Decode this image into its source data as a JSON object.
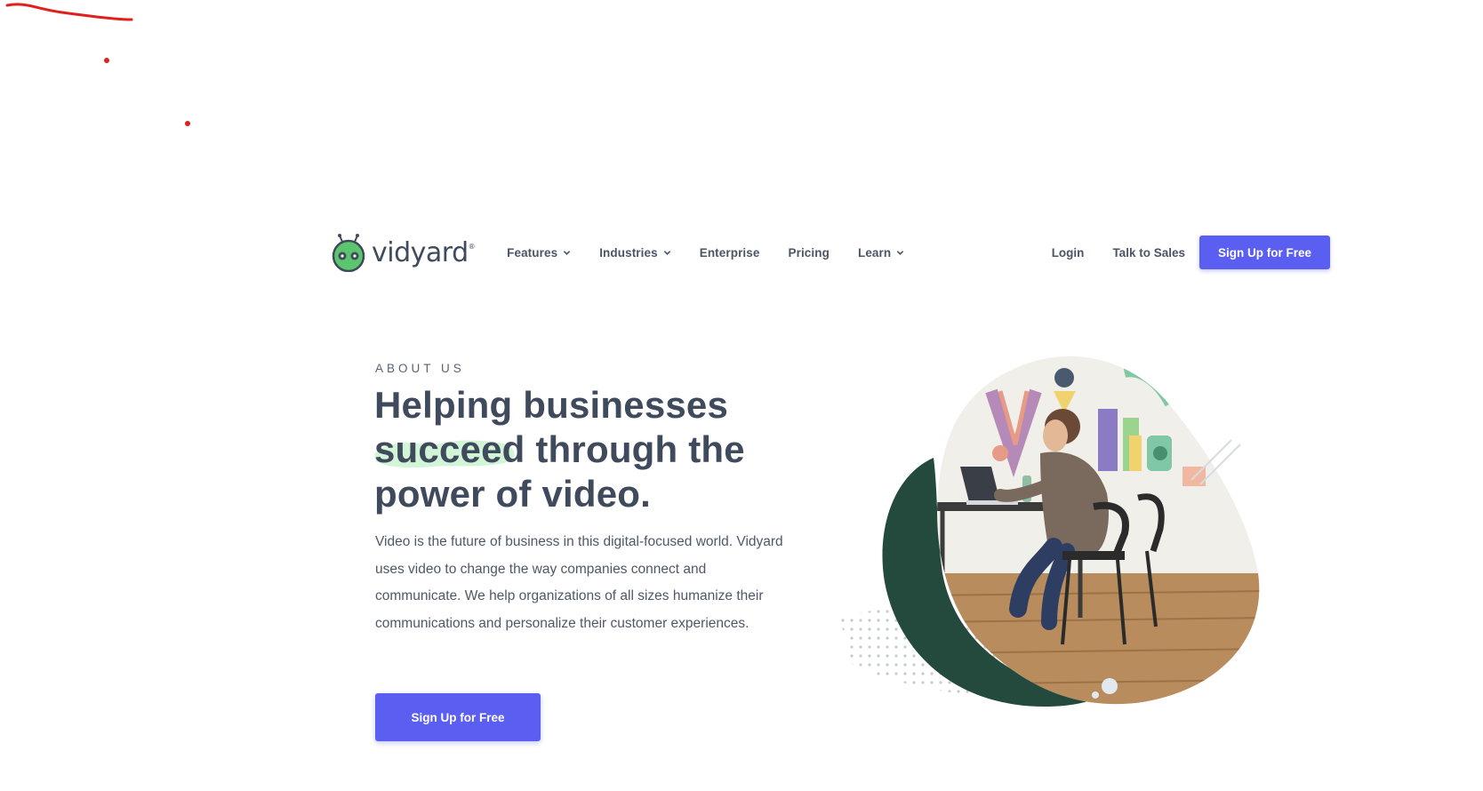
{
  "nav": {
    "logo_text": "vidyard",
    "logo_mark": "®",
    "menu": [
      {
        "label": "Features",
        "has_dropdown": true
      },
      {
        "label": "Industries",
        "has_dropdown": true
      },
      {
        "label": "Enterprise",
        "has_dropdown": false
      },
      {
        "label": "Pricing",
        "has_dropdown": false
      },
      {
        "label": "Learn",
        "has_dropdown": true
      }
    ],
    "login": "Login",
    "talk_to_sales": "Talk to Sales",
    "signup": "Sign Up for Free"
  },
  "hero": {
    "eyebrow": "ABOUT US",
    "headline_line1": "Helping businesses",
    "headline_line2": "succeed through the",
    "headline_line3": "power of video.",
    "highlight_word": "succeed",
    "description": "Video is the future of business in this digital-focused world. Vidyard uses video to change the way companies connect and communicate. We help organizations of all sizes humanize their communications and personalize their customer experiences.",
    "cta": "Sign Up for Free"
  },
  "colors": {
    "accent": "#5a5ff2",
    "text": "#3f4a5c",
    "dark_green": "#234a3c",
    "logo_green": "#5cc56e",
    "highlight_green": "#c9f3cf",
    "annotation_red": "#e0201c"
  }
}
